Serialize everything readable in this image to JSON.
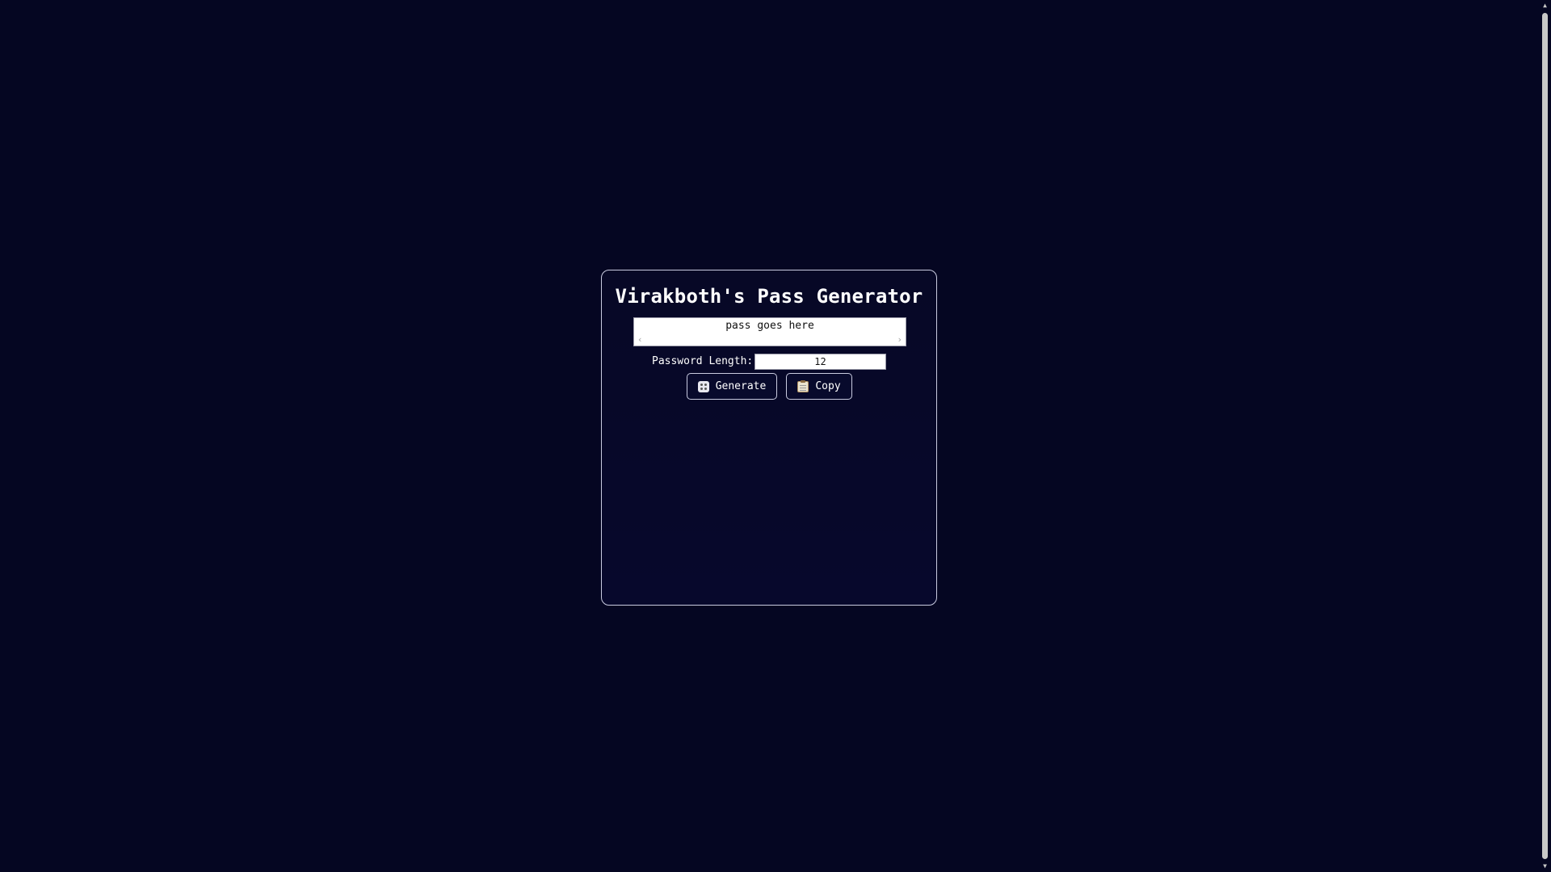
{
  "app": {
    "title": "Virakboth's Pass Generator"
  },
  "output": {
    "value": "pass goes here",
    "scroll_left": "‹",
    "scroll_right": "›"
  },
  "length": {
    "label": "Password Length:",
    "value": "12"
  },
  "buttons": {
    "generate_label": "Generate",
    "generate_icon": "dice-icon",
    "copy_label": "Copy",
    "copy_icon": "clipboard-icon"
  },
  "scrollbar": {
    "up_arrow": "▲",
    "down_arrow": "▼"
  },
  "colors": {
    "background": "#050622",
    "card_border": "#c9cbe0",
    "text": "#ffffff"
  }
}
